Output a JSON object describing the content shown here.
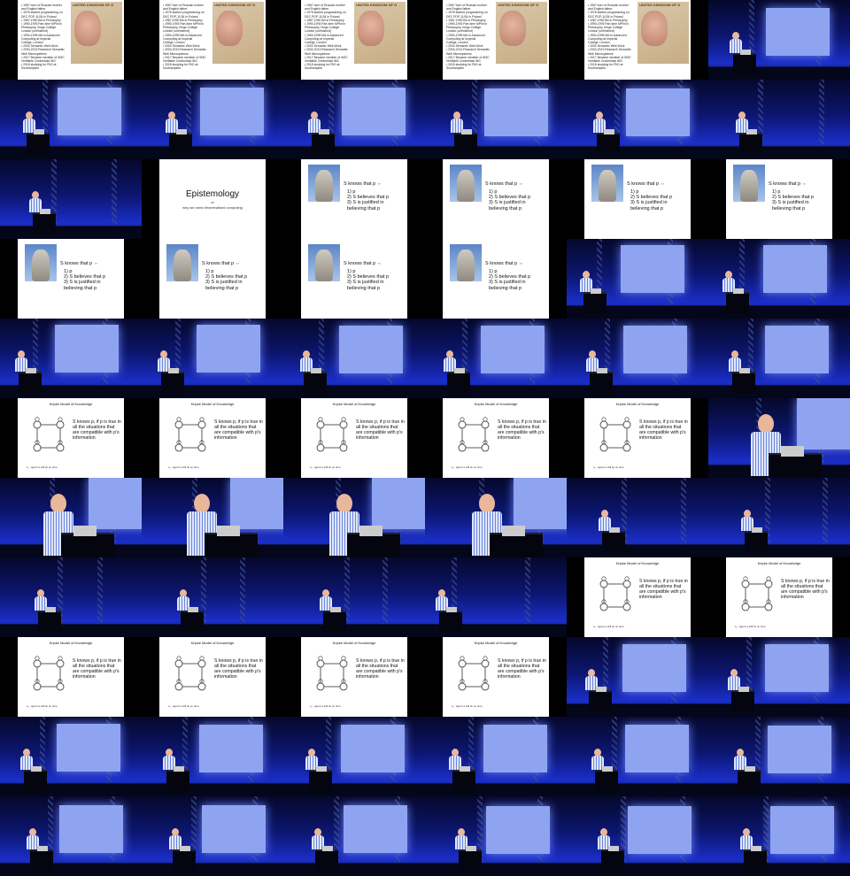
{
  "cells": [
    "bio",
    "bio",
    "bio",
    "bio",
    "bio",
    "stage-bio",
    "stage-bio",
    "stage-bio",
    "stage-bio",
    "stage-bio",
    "stage-bio",
    "stage-dark",
    "stage-dark",
    "epistemology",
    "sk",
    "sk",
    "sk",
    "sk",
    "sk",
    "sk",
    "sk",
    "sk",
    "stage-sk",
    "stage-sk",
    "stage-sk",
    "stage-sk",
    "stage-sk",
    "stage-sk",
    "stage-sk",
    "stage-kripke",
    "kripke",
    "kripke",
    "kripke",
    "kripke",
    "kripke",
    "close-right",
    "close",
    "close",
    "close",
    "close",
    "stage-dark",
    "stage-dark",
    "stage-dark",
    "stage-dark",
    "stage-dark",
    "stage-dark",
    "kripke",
    "kripke",
    "kripke",
    "kripke",
    "kripke",
    "kripke",
    "stage-kripke",
    "stage-kripke",
    "stage-kripke",
    "stage-kripke",
    "stage-kripke",
    "stage-kripke",
    "stage-kripke",
    "stage-kripke",
    "stage-kripke",
    "stage-kripke",
    "stage-kripke",
    "stage-kripke",
    "stage-kripke",
    "stage-kripke"
  ],
  "bio_slide": {
    "bullets": [
      "• 1967 born of Russian mother",
      "  and English father",
      "• 1978 started programming on",
      "  DEC PDP-11/34 in Poland",
      "• 1987-1990 BA in Philosophy",
      "• 1990-1993 Part-time MPhil in",
      "  Philosophy, Kings College",
      "  London (unfinished)",
      "• 1994-1995 MA in Advanced",
      "  Computing at Imperial",
      "  College, London",
      "• 2004 Semantic Web Work",
      "• 2004-2013 Research Semantic",
      "  Web Microsystems",
      "• 2017 Became member of W3C",
      "  Verifiable Credentials WG",
      "• 2018 studying for PhD at",
      "  Southampton"
    ],
    "passport_title": "UNITED KINGDOM OF G"
  },
  "epistemology_slide": {
    "title": "Epistemology",
    "or": "or",
    "subtitle": "why we need decentralised computing"
  },
  "sk_slide": {
    "heading": "S knows that p  ⇔",
    "lines": [
      "1) p",
      "2) S believes that p",
      "3) S is justified in",
      "     believing that p"
    ]
  },
  "kripke_slide": {
    "title": "Kripke Model of Knowledge",
    "text": "S knows p, if p is true in all the situations that are compatible with p's information",
    "caption": "s₁ : agent a still lie on time"
  },
  "colors": {
    "stage_blue": "#1a2ec8",
    "screen": "#8fa4f0",
    "background": "#000000"
  }
}
